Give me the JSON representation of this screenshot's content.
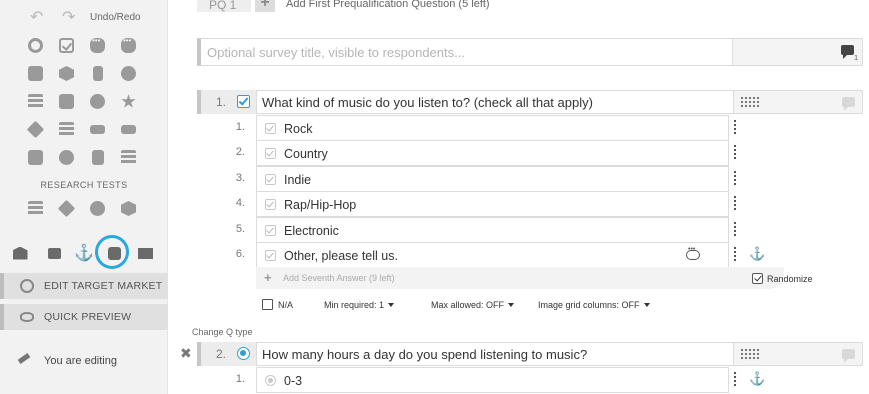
{
  "sidebar": {
    "undo_redo_label": "Undo/Redo",
    "question_type_icons": [
      "radio-icon",
      "checkbox-icon",
      "comment-bubble-icon",
      "chat-bubble-icon",
      "image-choice-icon",
      "image-grid-icon",
      "mobile-icon",
      "rating-icon",
      "matrix-icon",
      "text-box-icon",
      "smiley-icon",
      "star-icon",
      "ranking-icon",
      "list-icon",
      "slider-icon",
      "input-field-icon",
      "image-select-icon",
      "globe-icon",
      "clipboard-icon",
      "stack-icon"
    ],
    "research_tests_title": "RESEARCH TESTS",
    "research_test_icons": [
      "bar-chart-icon",
      "price-tag-icon",
      "palette-icon",
      "package-icon"
    ],
    "tools": [
      "bank-icon",
      "comment-icon",
      "anchor-icon",
      "share-icon",
      "print-icon"
    ],
    "edit_target_market_label": "EDIT TARGET MARKET",
    "quick_preview_label": "QUICK PREVIEW",
    "editing_label": "You are editing"
  },
  "prequal": {
    "tag": "PQ 1",
    "add_label": "Add First Prequalification Question (5 left)"
  },
  "survey_title": {
    "placeholder": "Optional survey title, visible to respondents...",
    "comment_count": "1"
  },
  "questions": [
    {
      "number": "1.",
      "type": "checkbox",
      "text": "What kind of music do you listen to? (check all that apply)",
      "answers": [
        {
          "number": "1.",
          "label": "Rock"
        },
        {
          "number": "2.",
          "label": "Country"
        },
        {
          "number": "3.",
          "label": "Indie"
        },
        {
          "number": "4.",
          "label": "Rap/Hip-Hop"
        },
        {
          "number": "5.",
          "label": "Electronic"
        },
        {
          "number": "6.",
          "label": "Other, please tell us."
        }
      ],
      "add_answer_label": "Add Seventh Answer (9 left)",
      "randomize_label": "Randomize",
      "options": {
        "na_label": "N/A",
        "min_required": "Min required:  1",
        "max_allowed": "Max allowed:  OFF",
        "image_grid": "Image grid columns:  OFF"
      }
    },
    {
      "number": "2.",
      "type": "radio",
      "text": "How many hours a day do you spend listening to music?",
      "answers": [
        {
          "number": "1.",
          "label": "0-3"
        }
      ]
    }
  ],
  "change_q_type_label": "Change Q type",
  "colors": {
    "accent": "#29a8e0",
    "sidebar_bg": "#f2f2f2",
    "border": "#dcdcdc"
  }
}
